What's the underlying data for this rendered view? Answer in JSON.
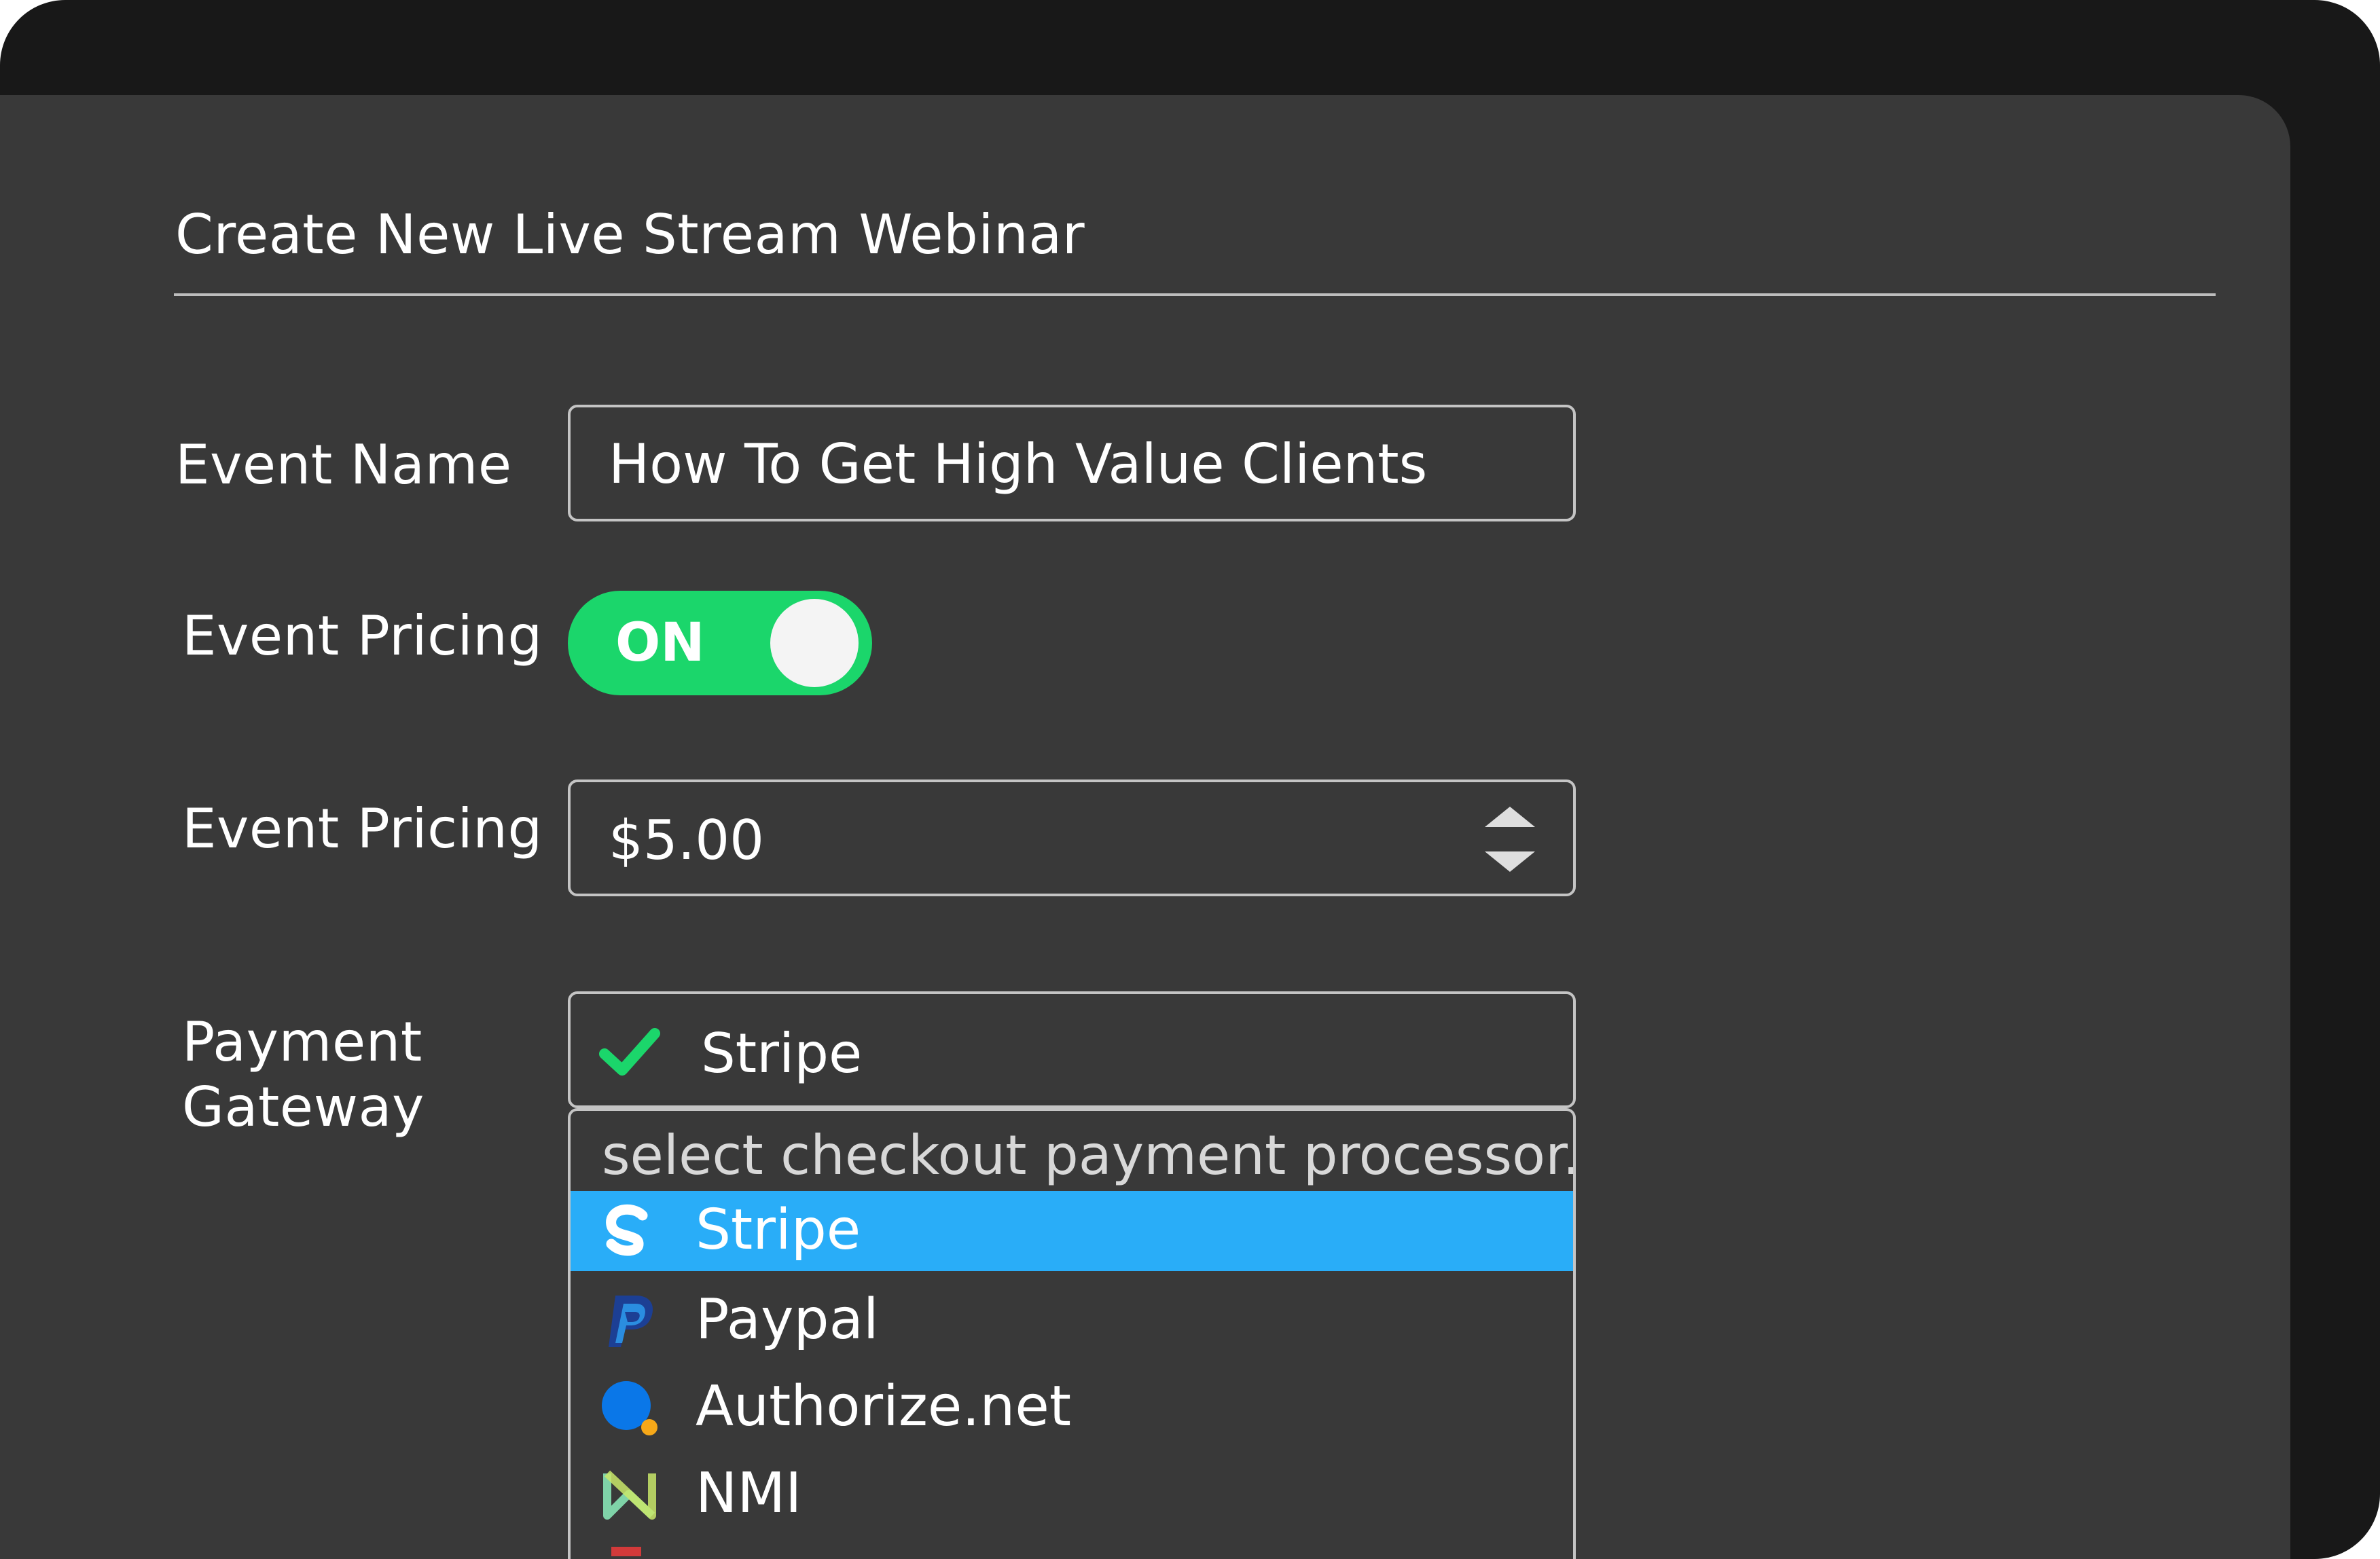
{
  "header": {
    "title": "Create New Live Stream Webinar"
  },
  "form": {
    "event_name": {
      "label": "Event Name",
      "value": "How To Get High Value Clients"
    },
    "pricing_toggle": {
      "label": "Event Pricing",
      "state": "ON"
    },
    "pricing_amount": {
      "label": "Event Pricing",
      "value": "$5.00"
    },
    "payment_gateway": {
      "label_line1": "Payment",
      "label_line2": "Gateway",
      "selected": "Stripe",
      "placeholder": "select checkout payment processor...",
      "options": [
        {
          "label": "Stripe",
          "icon": "stripe-icon",
          "selected": true
        },
        {
          "label": "Paypal",
          "icon": "paypal-icon",
          "selected": false
        },
        {
          "label": "Authorize.net",
          "icon": "authorize-net-icon",
          "selected": false
        },
        {
          "label": "NMI",
          "icon": "nmi-icon",
          "selected": false
        }
      ]
    }
  },
  "colors": {
    "background": "#181818",
    "panel": "#393939",
    "toggle_on": "#1bd66b",
    "selected_option": "#29adf8",
    "check": "#1bd66b"
  }
}
